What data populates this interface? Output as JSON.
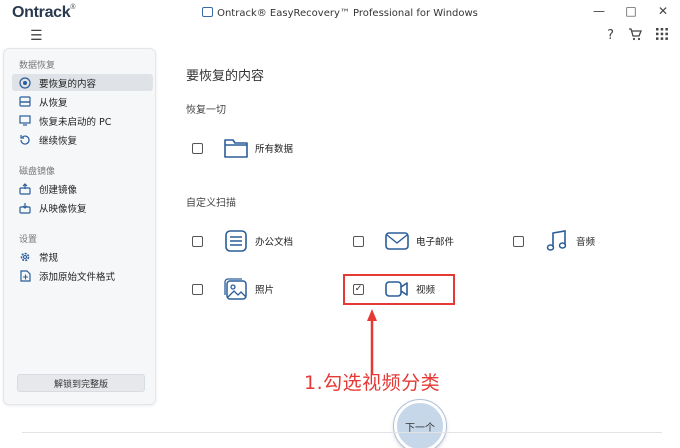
{
  "window": {
    "logo": "Ontrack",
    "logo_mark": "®",
    "title": "Ontrack® EasyRecovery™ Professional for Windows",
    "controls": [
      "—",
      "□",
      "✕"
    ]
  },
  "toolbar": {
    "menu_glyph": "☰",
    "help_glyph": "?",
    "cart_glyph": "🛒",
    "apps_glyph": "⠿"
  },
  "sidebar": {
    "sections": [
      {
        "label": "数据恢复",
        "items": [
          {
            "label": "要恢复的内容",
            "icon": "target-icon",
            "active": true
          },
          {
            "label": "从恢复",
            "icon": "drive-icon",
            "active": false
          },
          {
            "label": "恢复未启动的 PC",
            "icon": "pc-icon",
            "active": false
          },
          {
            "label": "继续恢复",
            "icon": "resume-icon",
            "active": false
          }
        ]
      },
      {
        "label": "磁盘镜像",
        "items": [
          {
            "label": "创建镜像",
            "icon": "create-image-icon",
            "active": false
          },
          {
            "label": "从映像恢复",
            "icon": "restore-image-icon",
            "active": false
          }
        ]
      },
      {
        "label": "设置",
        "items": [
          {
            "label": "常规",
            "icon": "gear-icon",
            "active": false
          },
          {
            "label": "添加原始文件格式",
            "icon": "add-format-icon",
            "active": false
          }
        ]
      }
    ],
    "unlock_label": "解锁到完整版"
  },
  "main": {
    "title": "要恢复的内容",
    "recover_all": {
      "label": "恢复一切",
      "options": [
        {
          "label": "所有数据",
          "icon": "folder-icon",
          "checked": false
        }
      ]
    },
    "custom_scan": {
      "label": "自定义扫描",
      "options": [
        {
          "label": "办公文档",
          "icon": "document-icon",
          "checked": false
        },
        {
          "label": "电子邮件",
          "icon": "email-icon",
          "checked": false
        },
        {
          "label": "音频",
          "icon": "music-icon",
          "checked": false
        },
        {
          "label": "照片",
          "icon": "photo-icon",
          "checked": false
        },
        {
          "label": "视频",
          "icon": "video-icon",
          "checked": true
        }
      ]
    },
    "check_mark": "✓",
    "annotation": "1.勾选视频分类",
    "next_label": "下一个"
  },
  "colors": {
    "accent": "#2a5d9a",
    "annotation_red": "#e53935",
    "sidebar_bg": "#f6f7f9",
    "active_item_bg": "#dfe2e7",
    "next_button_bg": "#c7d7ea"
  }
}
